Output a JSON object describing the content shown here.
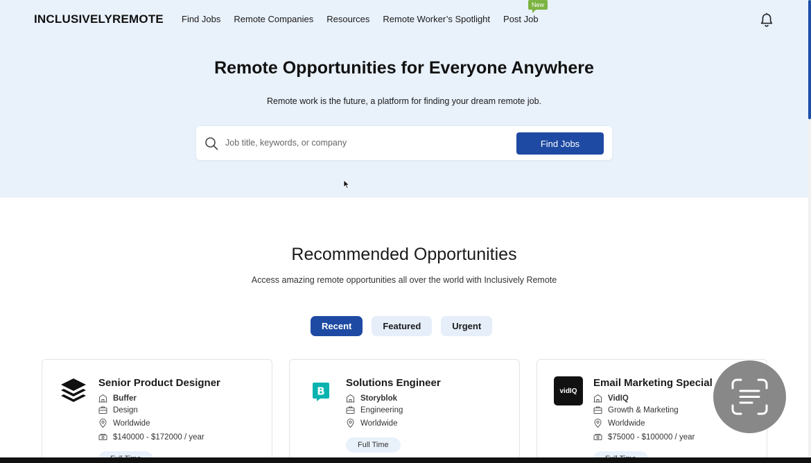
{
  "nav": {
    "logo": "INCLUSIVELYREMOTE",
    "links": [
      "Find Jobs",
      "Remote Companies",
      "Resources",
      "Remote Worker’s Spotlight",
      "Post Job"
    ],
    "new_badge": "New",
    "icons": {
      "notifications": "bell-icon"
    }
  },
  "hero": {
    "title": "Remote Opportunities for Everyone Anywhere",
    "subtitle": "Remote work is the future, a platform for finding your dream remote job.",
    "search": {
      "placeholder": "Job title, keywords, or company",
      "value": "",
      "button": "Find Jobs"
    }
  },
  "recommended": {
    "title": "Recommended Opportunities",
    "subtitle": "Access amazing remote opportunities all over the world with Inclusively Remote",
    "tabs": [
      "Recent",
      "Featured",
      "Urgent"
    ],
    "active_tab": "Recent"
  },
  "jobs": [
    {
      "title": "Senior Product Designer",
      "company": "Buffer",
      "category": "Design",
      "location": "Worldwide",
      "salary": "$140000 - $172000 / year",
      "type": "Full Time",
      "logo": "buffer-logo"
    },
    {
      "title": "Solutions Engineer",
      "company": "Storyblok",
      "category": "Engineering",
      "location": "Worldwide",
      "salary": "",
      "type": "Full Time",
      "logo": "storyblok-logo"
    },
    {
      "title": "Email Marketing Special",
      "company": "VidIQ",
      "category": "Growth & Marketing",
      "location": "Worldwide",
      "salary": "$75000 - $100000 / year",
      "type": "Full Time",
      "logo": "vidiq-logo",
      "logo_text": "vidIQ"
    }
  ],
  "colors": {
    "primary": "#1e4aa3",
    "hero_bg": "#e9f1fb",
    "new_badge": "#7cb342",
    "storyblok": "#09b3af"
  }
}
